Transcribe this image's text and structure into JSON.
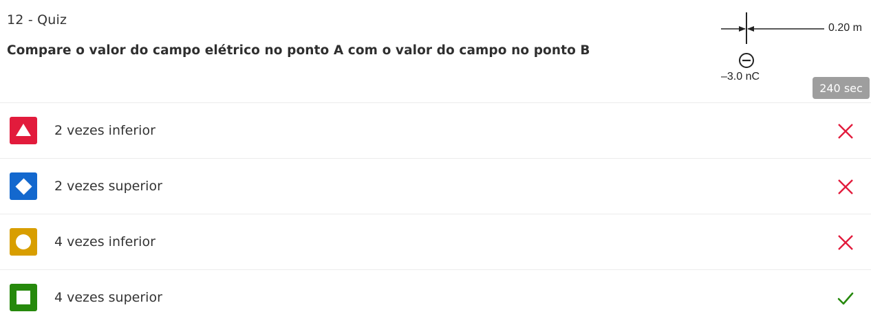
{
  "header": {
    "quiz_label": "12 - Quiz",
    "question": "Compare o valor do campo elétrico no ponto A com o valor do campo no ponto B",
    "timer": "240 sec"
  },
  "figure": {
    "distance_label": "0.20 m",
    "charge_label": "–3.0 nC",
    "charge_sign": "−"
  },
  "colors": {
    "red": "#e21b3c",
    "blue": "#1368ce",
    "yellow": "#d89e00",
    "green": "#26890c",
    "incorrect": "#e21b3c",
    "correct": "#26890c"
  },
  "options": [
    {
      "label": "2 vezes inferior",
      "shape": "triangle-icon",
      "color": "red",
      "result": "incorrect"
    },
    {
      "label": "2 vezes superior",
      "shape": "diamond-icon",
      "color": "blue",
      "result": "incorrect"
    },
    {
      "label": "4 vezes inferior",
      "shape": "circle-icon",
      "color": "yellow",
      "result": "incorrect"
    },
    {
      "label": "4 vezes superior",
      "shape": "square-icon",
      "color": "green",
      "result": "correct"
    }
  ]
}
